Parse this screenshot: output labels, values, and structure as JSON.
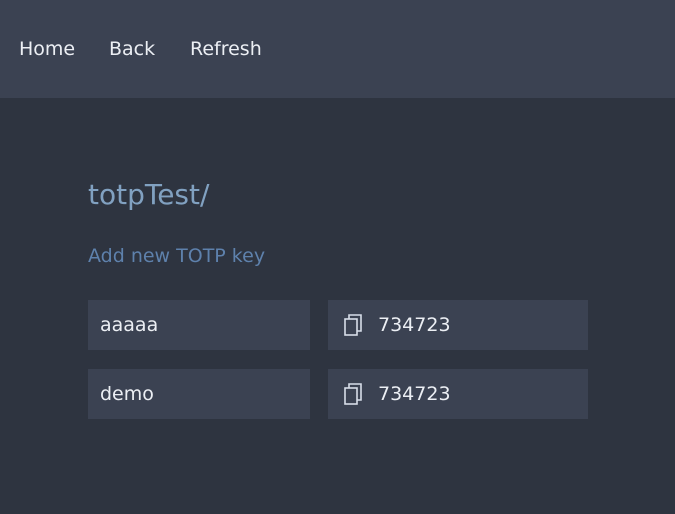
{
  "nav": {
    "home": "Home",
    "back": "Back",
    "refresh": "Refresh"
  },
  "page": {
    "title": "totpTest/",
    "add_link": "Add new TOTP key"
  },
  "keys": [
    {
      "name": "aaaaa",
      "code": "734723",
      "icon": "copy-icon"
    },
    {
      "name": "demo",
      "code": "734723",
      "icon": "copy-icon"
    }
  ],
  "colors": {
    "background": "#2e3440",
    "topbar": "#3b4252",
    "row_background": "#3b4252",
    "title": "#81a1c1",
    "link": "#5e81ac",
    "text": "#eceff4"
  }
}
